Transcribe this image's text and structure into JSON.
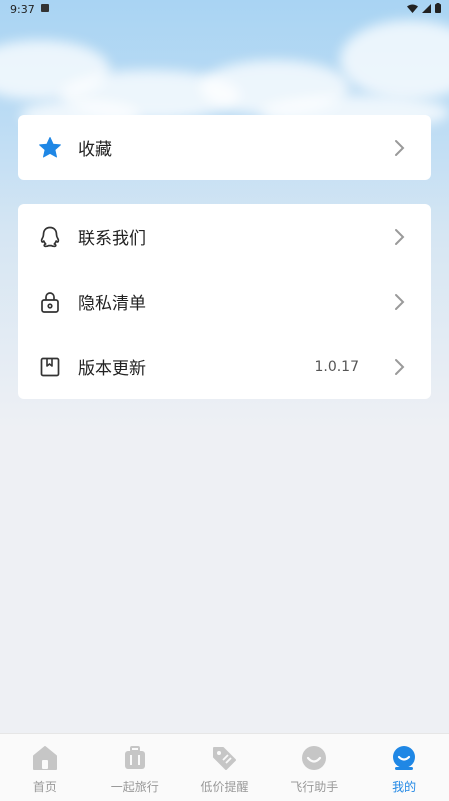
{
  "status_bar": {
    "time": "9:37"
  },
  "favorites_card": {
    "items": [
      {
        "label": "收藏",
        "icon": "star-icon"
      }
    ]
  },
  "menu_card": {
    "items": [
      {
        "label": "联系我们",
        "icon": "qq-icon",
        "value": ""
      },
      {
        "label": "隐私清单",
        "icon": "lock-icon",
        "value": ""
      },
      {
        "label": "版本更新",
        "icon": "bookmark-book-icon",
        "value": "1.0.17"
      }
    ]
  },
  "tabbar": {
    "tabs": [
      {
        "label": "首页",
        "icon": "home-icon"
      },
      {
        "label": "一起旅行",
        "icon": "suitcase-icon"
      },
      {
        "label": "低价提醒",
        "icon": "price-tag-icon"
      },
      {
        "label": "飞行助手",
        "icon": "smile-icon"
      },
      {
        "label": "我的",
        "icon": "profile-icon",
        "active": true
      }
    ]
  },
  "colors": {
    "accent": "#1f87e5",
    "inactive": "#c6c6c6"
  }
}
